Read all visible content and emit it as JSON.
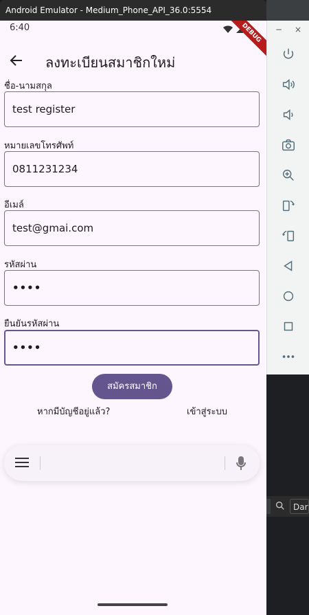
{
  "window": {
    "title": "Android Emulator - Medium_Phone_API_36.0:5554"
  },
  "side_panel": {
    "minimize": "−",
    "close": "×",
    "icons": [
      "power-icon",
      "volume-up-icon",
      "volume-down-icon",
      "camera-icon",
      "zoom-icon",
      "rotate-left-icon",
      "rotate-right-icon",
      "back-icon",
      "home-icon",
      "overview-icon",
      "more-icon"
    ]
  },
  "ide": {
    "theme_label": "Dar"
  },
  "status_bar": {
    "time": "6:40",
    "debug_banner": "DEBUG"
  },
  "app_bar": {
    "title": "ลงทะเบียนสมาชิกใหม่"
  },
  "form": {
    "fields": [
      {
        "label": "ชื่อ-นามสกุล",
        "value": "test register"
      },
      {
        "label": "หมายเลขโทรศัพท์",
        "value": "0811231234"
      },
      {
        "label": "อีเมล์",
        "value": "test@gmai.com"
      },
      {
        "label": "รหัสผ่าน",
        "value": "••••"
      },
      {
        "label": "ยืนยันรหัสผ่าน",
        "value": "••••"
      }
    ],
    "submit_label": "สมัครสมาชิก",
    "have_account": "หากมีบัญชีอยู่แล้ว?",
    "login_link": "เข้าสู่ระบบ"
  },
  "colors": {
    "primary": "#65558f",
    "background": "#fdf6fe",
    "outline": "#79747e"
  }
}
